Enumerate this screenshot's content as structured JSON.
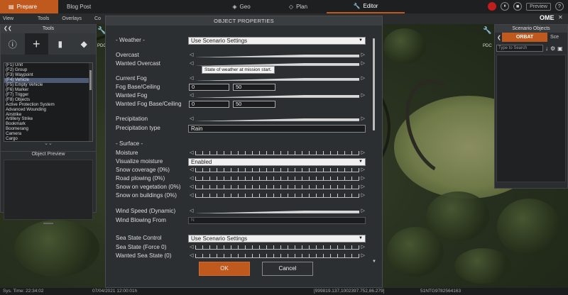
{
  "topbar": {
    "prepare": "Prepare",
    "blog_post": "Blog Post",
    "geo": "Geo",
    "plan": "Plan",
    "editor": "Editor",
    "preview": "Preview",
    "ome": "OME"
  },
  "menubar": [
    "View",
    "Tools",
    "Overlays",
    "Co"
  ],
  "tools_panel": {
    "title": "Tools",
    "items": [
      "(F1) Unit",
      "(F2) Group",
      "(F3) Waypoint",
      "(F4) Vehicle",
      "(F5) Empty Vehicle",
      "(F6) Marker",
      "(F7) Trigger",
      "(F8) Objects",
      "Active Protection System",
      "Advanced Wounding",
      "Airstrike",
      "Artillery Strike",
      "Bookmark",
      "Boomerang",
      "Camera",
      "Cargo"
    ],
    "selected_index": 3,
    "preview_title": "Object Preview"
  },
  "scenario_panel": {
    "title": "Scenario Objects",
    "tab_orbat": "ORBAT",
    "tab_other": "Sce",
    "search_placeholder": "Type to Search"
  },
  "modal": {
    "title": "OBJECT PROPERTIES",
    "weather_label": "- Weather -",
    "weather_value": "Use Scenario Settings",
    "overcast": "Overcast",
    "wanted_overcast": "Wanted Overcast",
    "tooltip": "State of weather at mission start.",
    "current_fog": "Current Fog",
    "fog_base_ceiling": "Fog Base/Ceiling",
    "fog_base": "0",
    "fog_ceiling": "50",
    "wanted_fog": "Wanted Fog",
    "wanted_fog_base_ceiling": "Wanted Fog Base/Ceiling",
    "wanted_fog_base": "0",
    "wanted_fog_ceiling": "50",
    "precipitation": "Precipitation",
    "precipitation_type": "Precipitation type",
    "precipitation_type_value": "Rain",
    "surface_label": "- Surface -",
    "moisture": "Moisture",
    "visualize_moisture": "Visualize moisture",
    "visualize_moisture_value": "Enabled",
    "snow_coverage": "Snow coverage (0%)",
    "road_plowing": "Road plowing (0%)",
    "snow_vegetation": "Snow on vegetation (0%)",
    "snow_buildings": "Snow on buildings (0%)",
    "wind_speed": "Wind Speed (Dynamic)",
    "wind_from": "Wind Blowing From",
    "wind_from_value": "N",
    "sea_state_control": "Sea State Control",
    "sea_state_control_value": "Use Scenario Settings",
    "sea_state": "Sea State (Force 0)",
    "wanted_sea_state": "Wanted Sea State (0)",
    "ok": "OK",
    "cancel": "Cancel"
  },
  "statusbar": {
    "sys_time": "Sys. Time: 22:34:02",
    "date": "07/04/2021 12:00:01h",
    "coords": "[999819.137,1002397.752,86.279]",
    "grid": "51NTG9782564163"
  },
  "colors": {
    "accent": "#c0591e",
    "panel": "#2c2f31",
    "record": "#c21d1d"
  }
}
